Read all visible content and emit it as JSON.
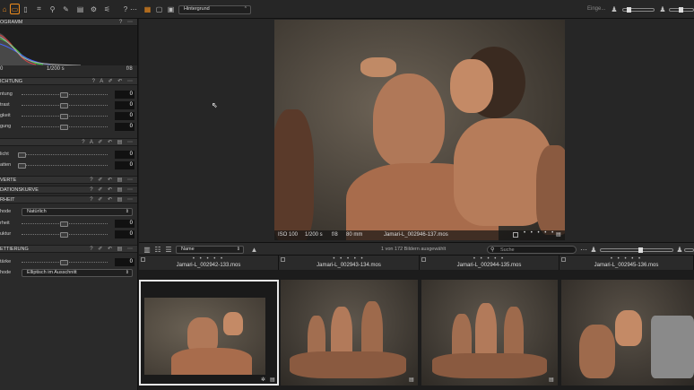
{
  "toolbar": {
    "gear_placeholder": "Einge...",
    "preset": "Hintergrund"
  },
  "histogram": {
    "title": "OGRAMM",
    "left": "0",
    "shutter": "1/200 s",
    "aperture": "f/8"
  },
  "exposure": {
    "title": "ICHTUNG",
    "rows": [
      {
        "label": "ntung",
        "value": "0"
      },
      {
        "label": "trast",
        "value": "0"
      },
      {
        "label": "gkeit",
        "value": "0"
      },
      {
        "label": "gung",
        "value": "0"
      }
    ]
  },
  "hdr": {
    "rows": [
      {
        "label": "licht",
        "value": "0"
      },
      {
        "label": "atten",
        "value": "0"
      }
    ]
  },
  "levels": {
    "title": "VERTE"
  },
  "curve": {
    "title": "DATIONSKURVE"
  },
  "clarity": {
    "title": "RHEIT",
    "method_label": "hode",
    "method_value": "Natürlich",
    "rows": [
      {
        "label": "rheit",
        "value": "0"
      },
      {
        "label": "uktur",
        "value": "0"
      }
    ]
  },
  "vignette": {
    "title": "ETTIERUNG",
    "amount_label": "tärke",
    "amount_value": "0",
    "method_label": "hode",
    "method_value": "Elliptisch im Ausschnitt"
  },
  "viewer": {
    "iso": "ISO 100",
    "shutter": "1/200 s",
    "aperture": "f/8",
    "focal": "80 mm",
    "filename": "Jamari-L_002946-137.mos"
  },
  "browser": {
    "sort": "Name",
    "count": "1 von 172 Bildern ausgewählt",
    "search_placeholder": "Suche"
  },
  "thumbnails": [
    {
      "name": "Jamari-L_002942-133.mos",
      "dots": "• • • • •"
    },
    {
      "name": "Jamari-L_002943-134.mos",
      "dots": "• • • • •"
    },
    {
      "name": "Jamari-L_002944-135.mos",
      "dots": "• • • • •"
    },
    {
      "name": "Jamari-L_002945-136.mos",
      "dots": "• • • • •"
    }
  ],
  "icons": [
    "folder-icon",
    "camera-icon",
    "crop-icon",
    "search-icon",
    "brush-icon",
    "metadata-icon",
    "gear-icon",
    "adjust-icon"
  ]
}
